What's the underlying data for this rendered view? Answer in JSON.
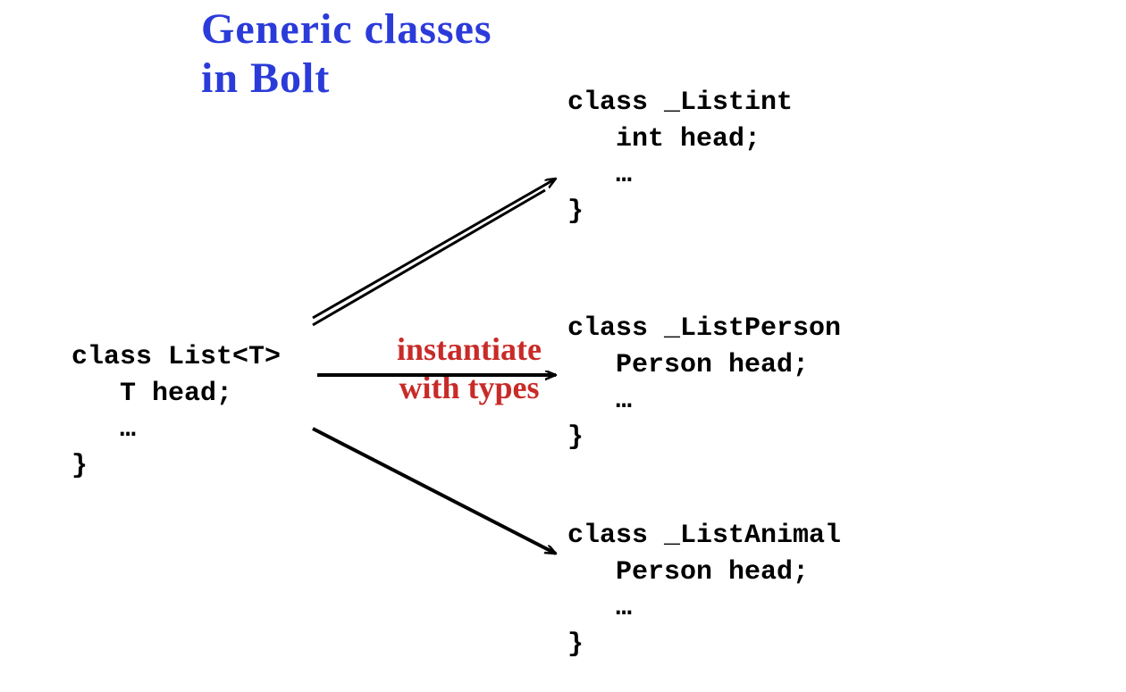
{
  "title": {
    "line1": "Generic classes",
    "line2": "in Bolt"
  },
  "generic_block": {
    "line1": "class List<T>",
    "line2": "   T head;",
    "line3": "   …",
    "line4": "}"
  },
  "annotation": {
    "line1": "instantiate",
    "line2": "with types"
  },
  "instantiations": [
    {
      "line1": "class _Listint",
      "line2": "   int head;",
      "line3": "   …",
      "line4": "}"
    },
    {
      "line1": "class _ListPerson",
      "line2": "   Person head;",
      "line3": "   …",
      "line4": "}"
    },
    {
      "line1": "class _ListAnimal",
      "line2": "   Person head;",
      "line3": "   …",
      "line4": "}"
    }
  ],
  "colors": {
    "title": "#2b3bd9",
    "annotation": "#c82b28",
    "arrows": "#000000"
  }
}
